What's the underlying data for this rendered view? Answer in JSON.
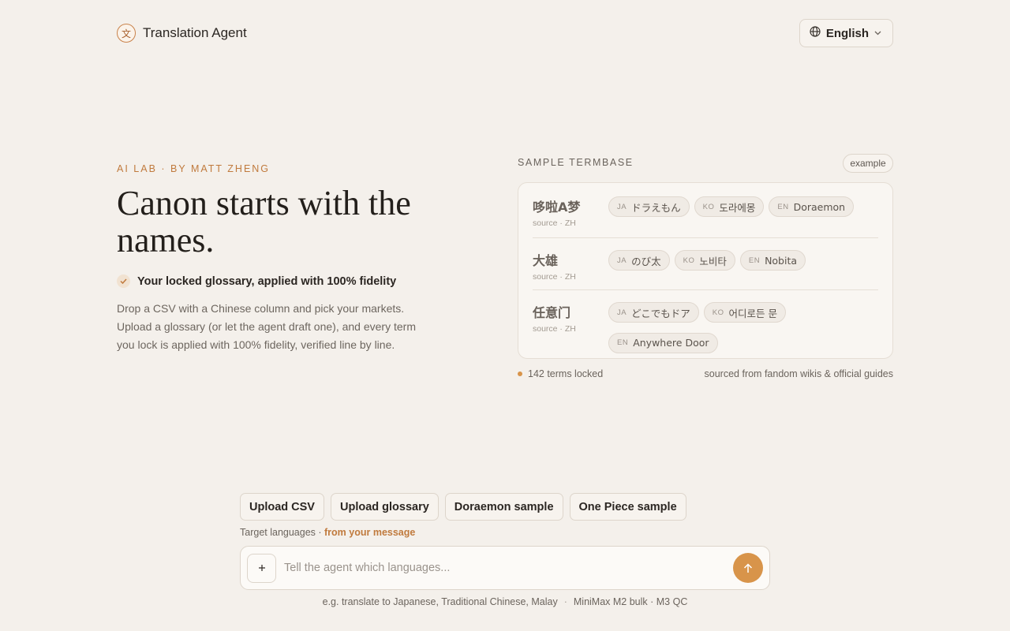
{
  "header": {
    "logo_glyph": "文",
    "app_name": "Translation Agent",
    "language": "English"
  },
  "hero": {
    "eyebrow": "AI LAB · BY MATT ZHENG",
    "headline": "Canon starts with the names.",
    "check_label": "Your locked glossary, applied with 100% fidelity",
    "description": "Drop a CSV with a Chinese column and pick your markets. Upload a glossary (or let the agent draft one), and every term you lock is applied with 100% fidelity, verified line by line."
  },
  "termbase": {
    "label": "SAMPLE TERMBASE",
    "example_badge": "example",
    "rows": [
      {
        "term": "哆啦A梦",
        "source_label": "source · ZH",
        "tags": [
          {
            "code": "JA",
            "value": "ドラえもん"
          },
          {
            "code": "KO",
            "value": "도라에몽"
          },
          {
            "code": "EN",
            "value": "Doraemon"
          }
        ]
      },
      {
        "term": "大雄",
        "source_label": "source · ZH",
        "tags": [
          {
            "code": "JA",
            "value": "のび太"
          },
          {
            "code": "KO",
            "value": "노비타"
          },
          {
            "code": "EN",
            "value": "Nobita"
          }
        ]
      },
      {
        "term": "任意门",
        "source_label": "source · ZH",
        "tags": [
          {
            "code": "JA",
            "value": "どこでもドア"
          },
          {
            "code": "KO",
            "value": "어디로든 문"
          },
          {
            "code": "EN",
            "value": "Anywhere Door"
          }
        ]
      }
    ],
    "terms_locked": "142 terms locked",
    "sourced_from": "sourced from fandom wikis & official guides"
  },
  "composer": {
    "actions": [
      "Upload CSV",
      "Upload glossary",
      "Doraemon sample",
      "One Piece sample"
    ],
    "target_prefix": "Target languages · ",
    "target_highlight": "from your message",
    "placeholder": "Tell the agent which languages...",
    "hint_example": "e.g. translate to Japanese, Traditional Chinese, Malay",
    "hint_model": "MiniMax M2 bulk · M3 QC"
  },
  "icons": {
    "language": "globe-icon",
    "dropdown": "chevron-down-icon",
    "check": "check-icon",
    "attach": "plus-icon",
    "send": "arrow-up-icon"
  },
  "colors": {
    "background": "#f4f0eb",
    "accent": "#d8944a",
    "accent_text": "#c07a3d"
  }
}
